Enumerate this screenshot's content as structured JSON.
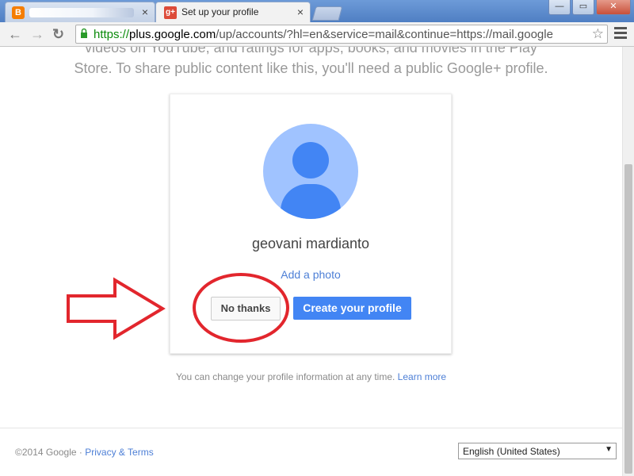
{
  "browser": {
    "tabs": [
      {
        "favicon": "blogger-icon",
        "title": ""
      },
      {
        "favicon": "google-plus-icon",
        "title": "Set up your profile"
      }
    ],
    "favicon_text": {
      "blogger": "B",
      "gplus": "g+"
    },
    "close_glyph": "×",
    "window_buttons": {
      "minimize": "—",
      "maximize": "▭",
      "close": "✕"
    },
    "nav": {
      "back": "←",
      "forward": "→",
      "reload": "↻"
    },
    "url": {
      "scheme": "https://",
      "host": "plus.google.com",
      "path": "/up/accounts/?hl=en&service=mail&continue=https://mail.google"
    },
    "star_glyph": "☆"
  },
  "page": {
    "intro_line1": "videos on YouTube, and ratings for apps, books, and movies in the Play",
    "intro_line2": "Store. To share public content like this, you'll need a public Google+ profile.",
    "card": {
      "name": "geovani mardianto",
      "add_photo": "Add a photo",
      "no_thanks": "No thanks",
      "create_profile": "Create your profile"
    },
    "change_info": "You can change your profile information at any time.",
    "learn_more": "Learn more",
    "footer": {
      "copyright": "©2014 Google · ",
      "privacy_terms": "Privacy & Terms",
      "language_selected": "English (United States)",
      "language_arrow": "▼"
    }
  },
  "colors": {
    "google_blue": "#4285f4",
    "avatar_bg": "#a0c3ff",
    "annotation_red": "#e2262d",
    "link_blue": "#4d7fd6"
  }
}
